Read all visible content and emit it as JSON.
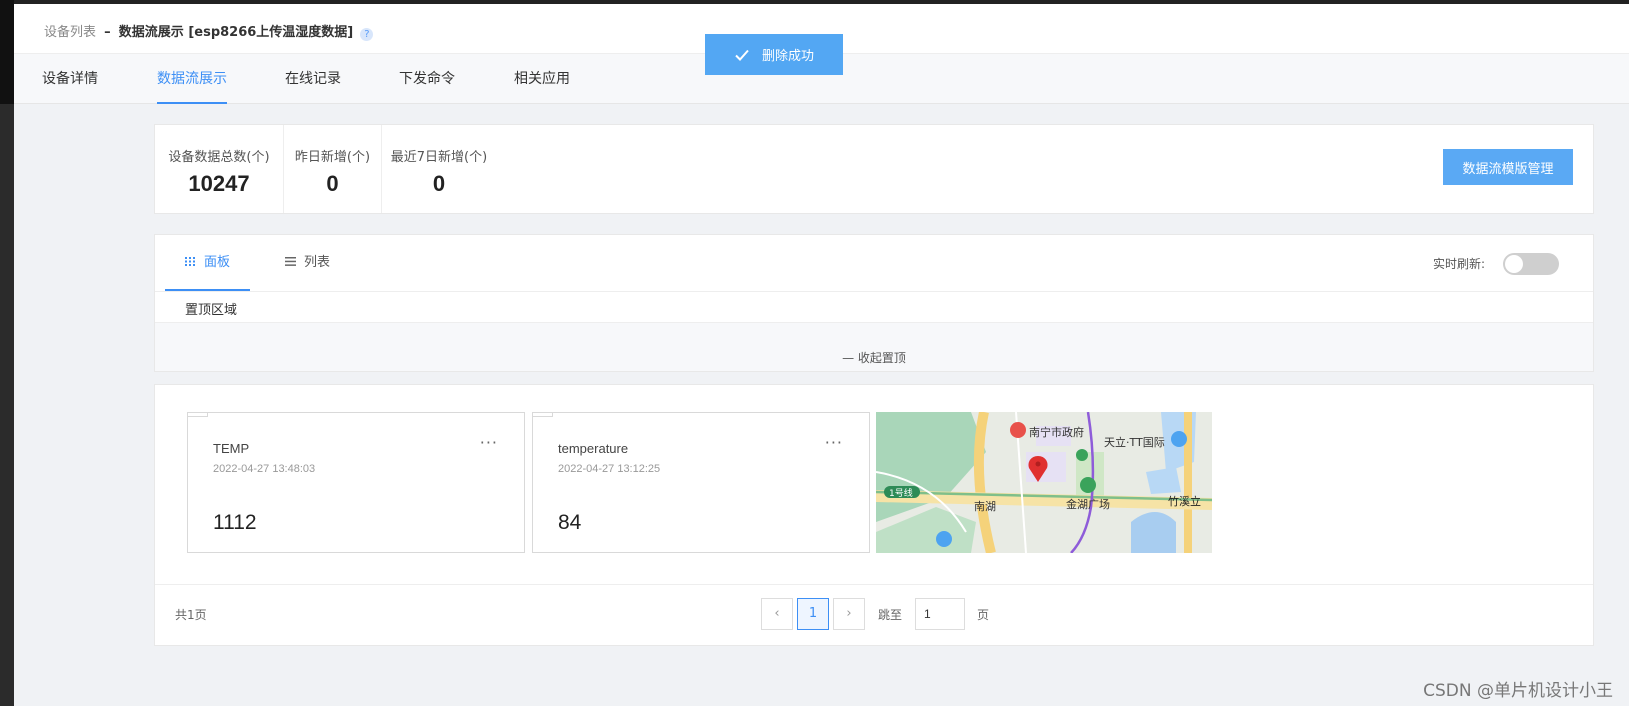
{
  "breadcrumb": {
    "device_list": "设备列表",
    "separator": "–",
    "current": "数据流展示 [esp8266上传温湿度数据]",
    "help": "?"
  },
  "tabs": [
    {
      "label": "设备详情",
      "active": false
    },
    {
      "label": "数据流展示",
      "active": true
    },
    {
      "label": "在线记录",
      "active": false
    },
    {
      "label": "下发命令",
      "active": false
    },
    {
      "label": "相关应用",
      "active": false
    }
  ],
  "toast": {
    "text": "删除成功",
    "icon": "check-icon"
  },
  "stats": [
    {
      "label": "设备数据总数(个)",
      "value": "10247"
    },
    {
      "label": "昨日新增(个)",
      "value": "0"
    },
    {
      "label": "最近7日新增(个)",
      "value": "0"
    }
  ],
  "manage_button": "数据流模版管理",
  "view_tabs": [
    {
      "label": "面板",
      "icon": "grid-icon",
      "active": true
    },
    {
      "label": "列表",
      "icon": "list-icon",
      "active": false
    }
  ],
  "realtime": {
    "label": "实时刷新:",
    "enabled": false
  },
  "pinned": {
    "title": "置顶区域",
    "collapse": "收起置顶"
  },
  "cards": [
    {
      "name": "TEMP",
      "time": "2022-04-27 13:48:03",
      "value": "1112",
      "more": "···"
    },
    {
      "name": "temperature",
      "time": "2022-04-27 13:12:25",
      "value": "84",
      "more": "···"
    }
  ],
  "map": {
    "labels": {
      "gov": "南宁市政府",
      "tianli": "天立·TT国际",
      "line": "1号线",
      "nanhu": "南湖",
      "jinhu": "金湖广场",
      "zhuxi": "竹溪立"
    }
  },
  "pagination": {
    "total": "共1页",
    "current": "1",
    "jump_label": "跳至",
    "jump_value": "1",
    "unit": "页"
  },
  "watermark": "CSDN @单片机设计小王",
  "colors": {
    "accent": "#3d8ff5",
    "toast": "#53a7f3",
    "button": "#5aa9f4"
  }
}
